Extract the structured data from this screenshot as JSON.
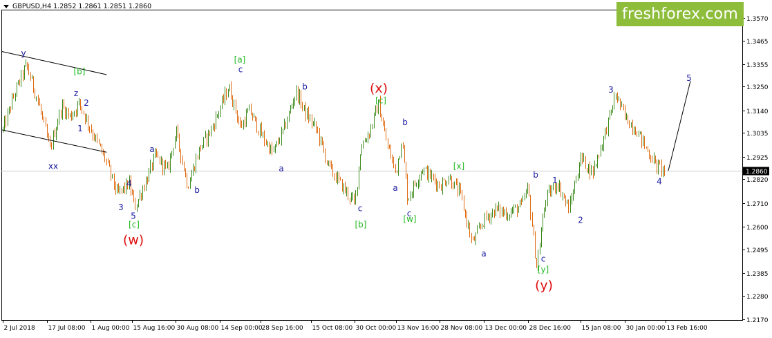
{
  "header": {
    "symbol": "GBPUSD,H4",
    "quotes": "1.2852 1.2861 1.2851 1.2860"
  },
  "logo": {
    "text": "freshforex.com",
    "background": "#8ebd3c"
  },
  "colors": {
    "up_candle": "#3a8a1a",
    "down_candle": "#e06a10",
    "axis_text": "#000000",
    "current_price_bg": "#000000",
    "wave_blue": "#1a1aa0",
    "wave_green": "#22bb22",
    "wave_red": "#dd1111",
    "trend_line": "#000000",
    "price_line": "#c8c8c8"
  },
  "chart_data": {
    "type": "candlestick",
    "symbol": "GBPUSD",
    "timeframe": "H4",
    "y_axis": {
      "ticks": [
        1.357,
        1.3465,
        1.3355,
        1.325,
        1.314,
        1.3035,
        1.2925,
        1.282,
        1.271,
        1.26,
        1.2495,
        1.2385,
        1.228,
        1.217
      ],
      "range": [
        1.2166,
        1.3608
      ]
    },
    "x_axis": {
      "ticks": [
        "2 Jul 2018",
        "17 Jul 08:00",
        "1 Aug 00:00",
        "15 Aug 16:00",
        "30 Aug 08:00",
        "14 Sep 00:00",
        "28 Sep 16:00",
        "15 Oct 08:00",
        "30 Oct 00:00",
        "13 Nov 16:00",
        "28 Nov 08:00",
        "13 Dec 00:00",
        "28 Dec 16:00",
        "15 Jan 08:00",
        "30 Jan 00:00",
        "13 Feb 16:00"
      ]
    },
    "current_price": 1.286,
    "price_path": [
      [
        "2 Jul 2018",
        1.305
      ],
      [
        "6 Jul 2018",
        1.322
      ],
      [
        "10 Jul 2018",
        1.335
      ],
      [
        "14 Jul 2018",
        1.318
      ],
      [
        "18 Jul 2018",
        1.296
      ],
      [
        "22 Jul 2018",
        1.316
      ],
      [
        "25 Jul 2018",
        1.311
      ],
      [
        "28 Jul 2018",
        1.3175
      ],
      [
        "1 Aug 2018",
        1.305
      ],
      [
        "6 Aug 2018",
        1.291
      ],
      [
        "10 Aug 2018",
        1.275
      ],
      [
        "14 Aug 2018",
        1.28
      ],
      [
        "16 Aug 2018",
        1.269
      ],
      [
        "20 Aug 2018",
        1.282
      ],
      [
        "23 Aug 2018",
        1.293
      ],
      [
        "27 Aug 2018",
        1.286
      ],
      [
        "30 Aug 2018",
        1.304
      ],
      [
        "3 Sep 2018",
        1.279
      ],
      [
        "7 Sep 2018",
        1.296
      ],
      [
        "11 Sep 2018",
        1.305
      ],
      [
        "14 Sep 2018",
        1.315
      ],
      [
        "17 Sep 2018",
        1.325
      ],
      [
        "21 Sep 2018",
        1.306
      ],
      [
        "24 Sep 2018",
        1.314
      ],
      [
        "28 Sep 2018",
        1.303
      ],
      [
        "2 Oct 2018",
        1.294
      ],
      [
        "6 Oct 2018",
        1.306
      ],
      [
        "10 Oct 2018",
        1.323
      ],
      [
        "13 Oct 2018",
        1.313
      ],
      [
        "17 Oct 2018",
        1.305
      ],
      [
        "21 Oct 2018",
        1.288
      ],
      [
        "25 Oct 2018",
        1.28
      ],
      [
        "30 Oct 2018",
        1.2705
      ],
      [
        "1 Nov 2018",
        1.297
      ],
      [
        "4 Nov 2018",
        1.304
      ],
      [
        "7 Nov 2018",
        1.317
      ],
      [
        "10 Nov 2018",
        1.298
      ],
      [
        "13 Nov 2018",
        1.285
      ],
      [
        "15 Nov 2018",
        1.301
      ],
      [
        "17 Nov 2018",
        1.273
      ],
      [
        "22 Nov 2018",
        1.287
      ],
      [
        "28 Nov 2018",
        1.279
      ],
      [
        "1 Dec 2018",
        1.283
      ],
      [
        "5 Dec 2018",
        1.275
      ],
      [
        "9 Dec 2018",
        1.252
      ],
      [
        "13 Dec 2018",
        1.263
      ],
      [
        "17 Dec 2018",
        1.268
      ],
      [
        "21 Dec 2018",
        1.266
      ],
      [
        "26 Dec 2018",
        1.27
      ],
      [
        "28 Dec 2018",
        1.278
      ],
      [
        "31 Dec 2018",
        1.2415
      ],
      [
        "3 Jan 2019",
        1.273
      ],
      [
        "7 Jan 2019",
        1.2805
      ],
      [
        "11 Jan 2019",
        1.268
      ],
      [
        "15 Jan 2019",
        1.292
      ],
      [
        "19 Jan 2019",
        1.285
      ],
      [
        "23 Jan 2019",
        1.302
      ],
      [
        "27 Jan 2019",
        1.3215
      ],
      [
        "30 Jan 2019",
        1.311
      ],
      [
        "3 Feb 2019",
        1.305
      ],
      [
        "6 Feb 2019",
        1.297
      ],
      [
        "10 Feb 2019",
        1.288
      ],
      [
        "13 Feb 2019",
        1.286
      ]
    ],
    "projection": [
      [
        "13 Feb 2019",
        1.286
      ],
      [
        "projected",
        1.3277
      ]
    ],
    "channel_lines": [
      {
        "from": [
          1.3414,
          "2 Jul 2018"
        ],
        "to": [
          1.3245,
          "28 Jul 2018"
        ]
      },
      {
        "from": [
          1.305,
          "2 Jul 2018"
        ],
        "to": [
          1.2886,
          "28 Jul 2018"
        ]
      }
    ],
    "wave_labels": [
      {
        "text": "y",
        "price": 1.3405,
        "color": "blue",
        "size": "small"
      },
      {
        "text": "[b]",
        "price": 1.332,
        "color": "green",
        "size": "small"
      },
      {
        "text": "z",
        "price": 1.322,
        "color": "blue",
        "size": "small"
      },
      {
        "text": "2",
        "price": 1.3175,
        "color": "blue",
        "size": "small"
      },
      {
        "text": "1",
        "price": 1.3055,
        "color": "blue",
        "size": "small"
      },
      {
        "text": "xx",
        "price": 1.288,
        "color": "blue",
        "size": "small"
      },
      {
        "text": "a",
        "price": 1.296,
        "color": "blue",
        "size": "small"
      },
      {
        "text": "4",
        "price": 1.28,
        "color": "blue",
        "size": "small"
      },
      {
        "text": "3",
        "price": 1.269,
        "color": "blue",
        "size": "small"
      },
      {
        "text": "5",
        "price": 1.265,
        "color": "blue",
        "size": "small"
      },
      {
        "text": "[c]",
        "price": 1.261,
        "color": "green",
        "size": "small"
      },
      {
        "text": "(w)",
        "price": 1.254,
        "color": "red",
        "size": "large"
      },
      {
        "text": "b",
        "price": 1.277,
        "color": "blue",
        "size": "small"
      },
      {
        "text": "[a]",
        "price": 1.3375,
        "color": "green",
        "size": "small"
      },
      {
        "text": "c",
        "price": 1.333,
        "color": "blue",
        "size": "small"
      },
      {
        "text": "a",
        "price": 1.287,
        "color": "blue",
        "size": "small"
      },
      {
        "text": "b",
        "price": 1.325,
        "color": "blue",
        "size": "small"
      },
      {
        "text": "(x)",
        "price": 1.3245,
        "color": "red",
        "size": "large"
      },
      {
        "text": "[c]",
        "price": 1.3185,
        "color": "green",
        "size": "small"
      },
      {
        "text": "b",
        "price": 1.3085,
        "color": "blue",
        "size": "small"
      },
      {
        "text": "a",
        "price": 1.278,
        "color": "blue",
        "size": "small"
      },
      {
        "text": "c",
        "price": 1.266,
        "color": "blue",
        "size": "small"
      },
      {
        "text": "[b]",
        "price": 1.261,
        "color": "green",
        "size": "small"
      },
      {
        "text": "c",
        "price": 1.2685,
        "color": "blue",
        "size": "small"
      },
      {
        "text": "[w]",
        "price": 1.2635,
        "color": "green",
        "size": "small"
      },
      {
        "text": "[x]",
        "price": 1.288,
        "color": "green",
        "size": "small"
      },
      {
        "text": "a",
        "price": 1.2475,
        "color": "blue",
        "size": "small"
      },
      {
        "text": "b",
        "price": 1.284,
        "color": "blue",
        "size": "small"
      },
      {
        "text": "1",
        "price": 1.2815,
        "color": "blue",
        "size": "small"
      },
      {
        "text": "c",
        "price": 1.245,
        "color": "blue",
        "size": "small"
      },
      {
        "text": "[y]",
        "price": 1.24,
        "color": "green",
        "size": "small"
      },
      {
        "text": "(y)",
        "price": 1.233,
        "color": "red",
        "size": "large"
      },
      {
        "text": "2",
        "price": 1.263,
        "color": "blue",
        "size": "small"
      },
      {
        "text": "3",
        "price": 1.3235,
        "color": "blue",
        "size": "small"
      },
      {
        "text": "4",
        "price": 1.281,
        "color": "blue",
        "size": "small"
      },
      {
        "text": "5",
        "price": 1.329,
        "color": "blue",
        "size": "small"
      }
    ]
  }
}
